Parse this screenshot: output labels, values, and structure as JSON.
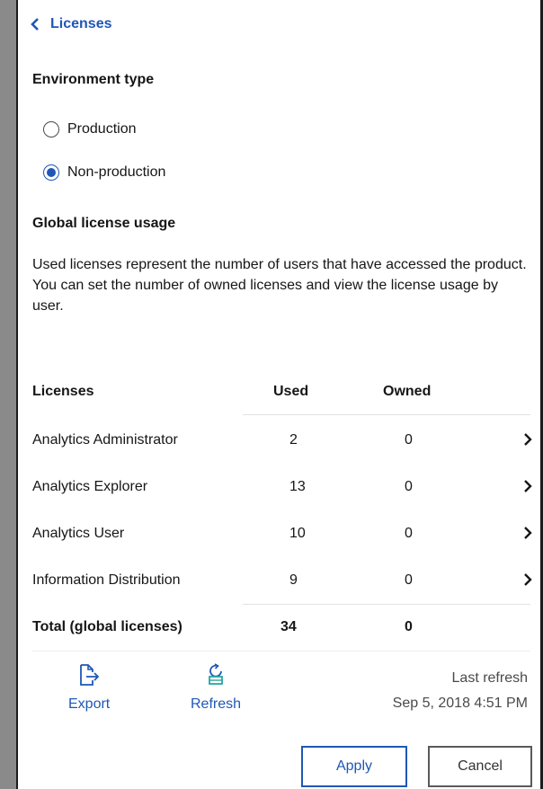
{
  "header": {
    "back_label": "Licenses"
  },
  "environment": {
    "title": "Environment type",
    "options": [
      {
        "label": "Production",
        "selected": false
      },
      {
        "label": "Non-production",
        "selected": true
      }
    ]
  },
  "usage": {
    "title": "Global license usage",
    "description": "Used licenses represent the number of users that have accessed the product. You can set the number of owned licenses and view the license usage by user."
  },
  "table": {
    "columns": [
      "Licenses",
      "Used",
      "Owned"
    ],
    "rows": [
      {
        "name": "Analytics Administrator",
        "used": "2",
        "owned": "0"
      },
      {
        "name": "Analytics Explorer",
        "used": "13",
        "owned": "0"
      },
      {
        "name": "Analytics User",
        "used": "10",
        "owned": "0"
      },
      {
        "name": "Information Distribution",
        "used": "9",
        "owned": "0"
      }
    ],
    "total": {
      "name": "Total (global licenses)",
      "used": "34",
      "owned": "0"
    }
  },
  "actions": {
    "export_label": "Export",
    "refresh_label": "Refresh",
    "last_refresh_label": "Last refresh",
    "last_refresh_time": "Sep 5, 2018 4:51 PM"
  },
  "buttons": {
    "apply": "Apply",
    "cancel": "Cancel"
  },
  "colors": {
    "accent": "#1f57b5",
    "refresh_icon_teal": "#2aa5a0"
  }
}
